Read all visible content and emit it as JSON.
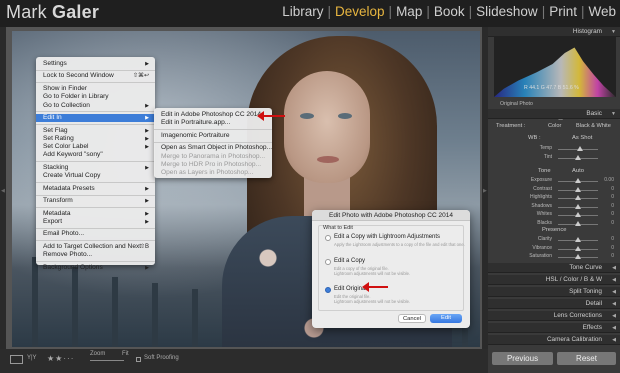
{
  "brand": {
    "first": "Mark",
    "last": "Galer"
  },
  "modules": [
    {
      "label": "Library",
      "active": false
    },
    {
      "label": "Develop",
      "active": true
    },
    {
      "label": "Map",
      "active": false
    },
    {
      "label": "Book",
      "active": false
    },
    {
      "label": "Slideshow",
      "active": false
    },
    {
      "label": "Print",
      "active": false
    },
    {
      "label": "Web",
      "active": false
    }
  ],
  "context_menu": {
    "items": [
      {
        "label": "Settings",
        "arrow": true
      },
      {
        "sep": true
      },
      {
        "label": "Lock to Second Window",
        "shortcut": "⇧⌘↩"
      },
      {
        "sep": true
      },
      {
        "label": "Show in Finder"
      },
      {
        "label": "Go to Folder in Library"
      },
      {
        "label": "Go to Collection",
        "arrow": true
      },
      {
        "sep": true
      },
      {
        "label": "Edit In",
        "arrow": true,
        "highlighted": true
      },
      {
        "sep": true
      },
      {
        "label": "Set Flag",
        "arrow": true
      },
      {
        "label": "Set Rating",
        "arrow": true
      },
      {
        "label": "Set Color Label",
        "arrow": true
      },
      {
        "label": "Add Keyword \"sony\""
      },
      {
        "sep": true
      },
      {
        "label": "Stacking",
        "arrow": true
      },
      {
        "label": "Create Virtual Copy"
      },
      {
        "sep": true
      },
      {
        "label": "Metadata Presets",
        "arrow": true
      },
      {
        "sep": true
      },
      {
        "label": "Transform",
        "arrow": true
      },
      {
        "sep": true
      },
      {
        "label": "Metadata",
        "arrow": true
      },
      {
        "label": "Export",
        "arrow": true
      },
      {
        "sep": true
      },
      {
        "label": "Email Photo..."
      },
      {
        "sep": true
      },
      {
        "label": "Add to Target Collection and Next",
        "shortcut": "⇧B"
      },
      {
        "label": "Remove Photo..."
      },
      {
        "sep": true
      },
      {
        "label": "Background Options",
        "arrow": true
      }
    ]
  },
  "submenu": {
    "items": [
      {
        "label": "Edit in Adobe Photoshop CC 2014..."
      },
      {
        "label": "Edit in Portraiture.app..."
      },
      {
        "sep": true
      },
      {
        "label": "Imagenomic Portraiture"
      },
      {
        "sep": true
      },
      {
        "label": "Open as Smart Object in Photoshop..."
      },
      {
        "label": "Merge to Panorama in Photoshop...",
        "disabled": true
      },
      {
        "label": "Merge to HDR Pro in Photoshop...",
        "disabled": true
      },
      {
        "label": "Open as Layers in Photoshop...",
        "disabled": true
      }
    ]
  },
  "dialog": {
    "title": "Edit Photo with Adobe Photoshop CC 2014",
    "group_label": "What to Edit",
    "options": [
      {
        "label": "Edit a Copy with Lightroom Adjustments",
        "desc": "Apply the Lightroom adjustments to a copy of the file and edit that one.",
        "selected": false
      },
      {
        "label": "Edit a Copy",
        "desc": "Edit a copy of the original file.",
        "desc2": "Lightroom adjustments will not be visible.",
        "selected": false
      },
      {
        "label": "Edit Original",
        "desc": "Edit the original file.",
        "desc2": "Lightroom adjustments will not be visible.",
        "selected": true
      }
    ],
    "cancel": "Cancel",
    "ok": "Edit"
  },
  "right_panel": {
    "histogram": {
      "title": "Histogram",
      "readout": "R  44.1  G  47.7  B  51.6  %"
    },
    "original_photo": "Original Photo",
    "basic": {
      "title": "Basic",
      "treatment_label": "Treatment :",
      "color": "Color",
      "bw": "Black & White",
      "wb_label": "WB :",
      "wb_value": "As Shot",
      "tone_label": "Tone",
      "auto": "Auto",
      "presence_label": "Presence",
      "sliders_wb": [
        {
          "label": "Temp",
          "pos": 0.55
        },
        {
          "label": "Tint",
          "pos": 0.5
        }
      ],
      "sliders_tone": [
        {
          "label": "Exposure",
          "pos": 0.5,
          "value": "0.00"
        },
        {
          "label": "Contrast",
          "pos": 0.5,
          "value": "0"
        },
        {
          "label": "Highlights",
          "pos": 0.5,
          "value": "0"
        },
        {
          "label": "Shadows",
          "pos": 0.5,
          "value": "0"
        },
        {
          "label": "Whites",
          "pos": 0.5,
          "value": "0"
        },
        {
          "label": "Blacks",
          "pos": 0.5,
          "value": "0"
        }
      ],
      "sliders_presence": [
        {
          "label": "Clarity",
          "pos": 0.5,
          "value": "0"
        },
        {
          "label": "Vibrance",
          "pos": 0.5,
          "value": "0"
        },
        {
          "label": "Saturation",
          "pos": 0.5,
          "value": "0"
        }
      ]
    },
    "panels": [
      "Tone Curve",
      "HSL / Color / B & W",
      "Split Toning",
      "Detail",
      "Lens Corrections",
      "Effects",
      "Camera Calibration"
    ],
    "previous": "Previous",
    "reset": "Reset"
  },
  "bottom_bar": {
    "zoom_label": "Zoom",
    "fit": "Fit",
    "soft_proofing": "Soft Proofing",
    "rating": 2
  }
}
